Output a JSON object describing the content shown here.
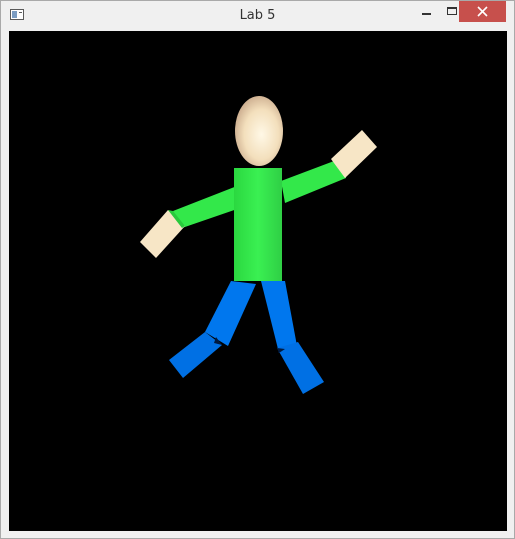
{
  "window": {
    "title": "Lab 5",
    "icon": "app-window-icon"
  },
  "controls": {
    "minimize_icon": "minimize-icon",
    "maximize_icon": "maximize-icon",
    "close_icon": "close-icon",
    "close_color": "#c7504c"
  },
  "scene": {
    "background": "#000000",
    "colors": {
      "skin": "#f7e6c6",
      "shirt": "#33e84a",
      "pants": "#0077ee"
    }
  }
}
